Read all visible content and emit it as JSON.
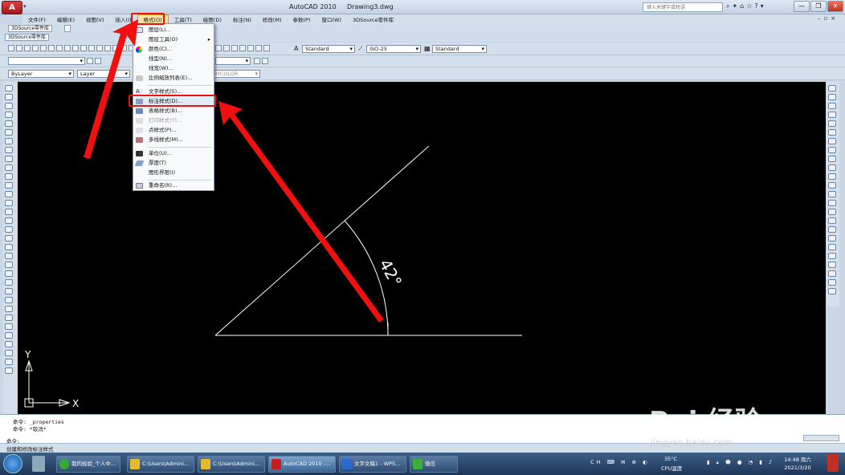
{
  "title_bar": {
    "app_button": "A",
    "app_name": "AutoCAD 2010",
    "document": "Drawing3.dwg",
    "search_placeholder": "键入关键字或短语",
    "window_controls": [
      "—",
      "❐",
      "✕"
    ]
  },
  "menubar": {
    "items": [
      "文件(F)",
      "编辑(E)",
      "视图(V)",
      "插入(I)",
      "格式(O)",
      "工具(T)",
      "绘图(D)",
      "标注(N)",
      "修改(M)",
      "参数(P)",
      "窗口(W)",
      "3DSource零件库"
    ],
    "active_index": 4
  },
  "tabs": {
    "tab1": "3DSource零件库",
    "tab2": "3DSource零件库"
  },
  "styles_toolbar": {
    "text_style": "Standard",
    "dim_style": "ISO-25",
    "table_style": "Standard"
  },
  "properties_toolbar": {
    "color": "ByLayer",
    "linetype": "Layer",
    "plot_style": "BYCOLOR"
  },
  "format_menu": {
    "items": [
      {
        "label": "图层(L)...",
        "icon": "layer-icon",
        "enabled": true
      },
      {
        "label": "图层工具(O)",
        "icon": "",
        "enabled": true,
        "submenu": true
      },
      {
        "label": "颜色(C)...",
        "icon": "color-wheel-icon",
        "enabled": true
      },
      {
        "label": "线型(N)...",
        "icon": "",
        "enabled": true
      },
      {
        "label": "线宽(W)...",
        "icon": "",
        "enabled": true
      },
      {
        "label": "比例缩放列表(E)...",
        "icon": "scale-list-icon",
        "enabled": true
      },
      {
        "label": "文字样式(S)...",
        "icon": "text-style-icon",
        "enabled": true
      },
      {
        "label": "标注样式(D)...",
        "icon": "dim-style-icon",
        "enabled": true
      },
      {
        "label": "表格样式(B)...",
        "icon": "table-style-icon",
        "enabled": true
      },
      {
        "label": "打印样式(Y)...",
        "icon": "plot-style-icon",
        "enabled": false
      },
      {
        "label": "点样式(P)...",
        "icon": "point-style-icon",
        "enabled": true
      },
      {
        "label": "多线样式(M)...",
        "icon": "mline-style-icon",
        "enabled": true
      },
      {
        "label": "单位(U)...",
        "icon": "units-icon",
        "enabled": true
      },
      {
        "label": "厚度(T)",
        "icon": "thickness-icon",
        "enabled": true
      },
      {
        "label": "图形界限(I)",
        "icon": "",
        "enabled": true
      },
      {
        "label": "重命名(R)...",
        "icon": "rename-icon",
        "enabled": true
      }
    ],
    "highlighted_index": 7
  },
  "drawing": {
    "angle_label": "42°",
    "ucs_x": "X",
    "ucs_y": "Y"
  },
  "command_line": {
    "line1": "命令: _properties",
    "line2": "命令: *取消*",
    "prompt": "命令:"
  },
  "status_bar": {
    "text": "创建和修改标注样式"
  },
  "taskbar": {
    "tasks": [
      "我的经验_个人中...",
      "C:\\Users\\Admini...",
      "C:\\Users\\Admini...",
      "AutoCAD 2010 -...",
      "文字文稿1 - WPS...",
      "微信"
    ],
    "active_index": 3,
    "temperature": "35°C",
    "temp_label": "CPU温度",
    "time": "14:48 周六",
    "date": "2021/3/20"
  },
  "watermark": {
    "brand": "Bai 经验",
    "url": "jingyan.baidu.com"
  },
  "colors": {
    "highlight_box": "#f01010",
    "canvas": "#000000",
    "menu_active": "#fbe3a6"
  }
}
